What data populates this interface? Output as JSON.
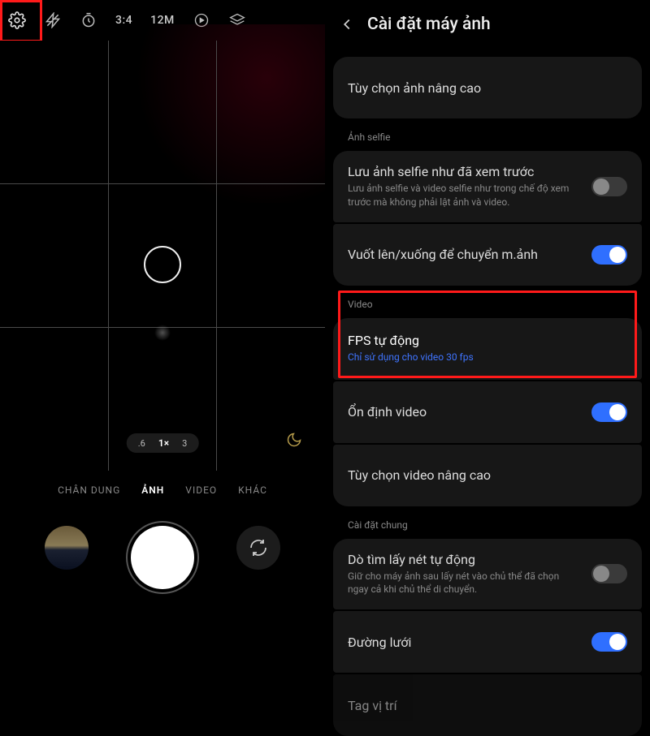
{
  "camera": {
    "topbar": {
      "ratio": "3:4",
      "resolution": "12M"
    },
    "zoom": {
      "wide": ".6",
      "main": "1×",
      "tele": "3"
    },
    "modes": {
      "portrait": "CHÂN DUNG",
      "photo": "ẢNH",
      "video": "VIDEO",
      "more": "KHÁC"
    }
  },
  "settings": {
    "title": "Cài đặt máy ảnh",
    "adv_photo": "Tùy chọn ảnh nâng cao",
    "selfie_section": "Ảnh selfie",
    "selfie_save_title": "Lưu ảnh selfie như đã xem trước",
    "selfie_save_sub": "Lưu ảnh selfie và video selfie như trong chế độ xem trước mà không phải lật ảnh và video.",
    "swipe_title": "Vuốt lên/xuống để chuyển m.ảnh",
    "video_section": "Video",
    "fps_title": "FPS tự động",
    "fps_sub": "Chỉ sử dụng cho video 30 fps",
    "stabilize": "Ổn định video",
    "adv_video": "Tùy chọn video nâng cao",
    "general_section": "Cài đặt chung",
    "af_title": "Dò tìm lấy nét tự động",
    "af_sub": "Giữ cho máy ảnh sau lấy nét vào chủ thể đã chọn ngay cả khi chủ thể di chuyển.",
    "grid": "Đường lưới",
    "tag": "Tag vị trí"
  }
}
